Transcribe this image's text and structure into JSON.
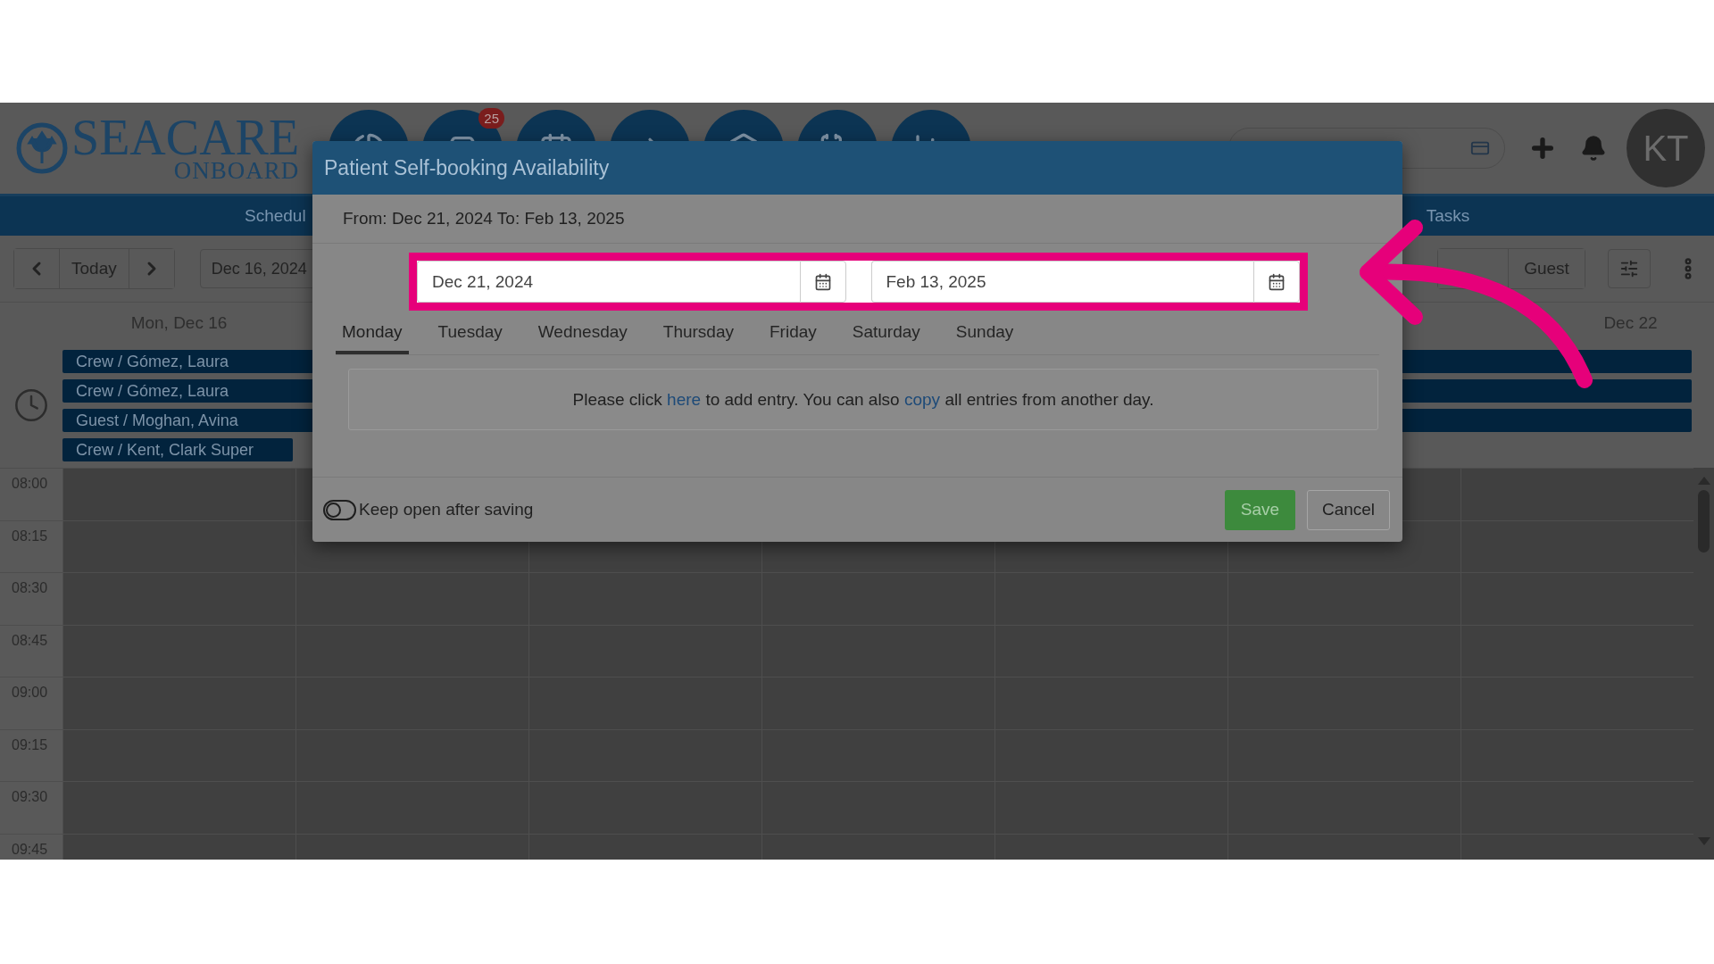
{
  "header": {
    "logo": {
      "name": "SEACARE",
      "sub": "ONBOARD"
    },
    "nav_badge": "25",
    "avatar": "KT"
  },
  "nav_bar": {
    "items": [
      "Schedul",
      "Tasks"
    ]
  },
  "toolbar": {
    "today": "Today",
    "date": "Dec 16, 2024",
    "view": "Guest"
  },
  "calendar": {
    "days": [
      "Mon, Dec 16",
      "Dec 22"
    ],
    "events": [
      {
        "label": "Crew / Gómez, Laura",
        "kind": "week"
      },
      {
        "label": "Crew / Gómez, Laura",
        "kind": "week"
      },
      {
        "label": "Guest / Moghan, Avina",
        "kind": "week"
      },
      {
        "label": "Crew / Kent, Clark Super",
        "kind": "day"
      }
    ],
    "times": [
      "08:00",
      "08:15",
      "08:30",
      "08:45",
      "09:00",
      "09:15",
      "09:30",
      "09:45"
    ]
  },
  "modal": {
    "title": "Patient Self-booking Availability",
    "range": "From: Dec 21, 2024 To: Feb 13, 2025",
    "from_date": "Dec 21, 2024",
    "to_date": "Feb 13, 2025",
    "tabs": [
      {
        "label": "Monday",
        "selected": true
      },
      {
        "label": "Tuesday",
        "selected": false
      },
      {
        "label": "Wednesday",
        "selected": false
      },
      {
        "label": "Thursday",
        "selected": false
      },
      {
        "label": "Friday",
        "selected": false
      },
      {
        "label": "Saturday",
        "selected": false
      },
      {
        "label": "Sunday",
        "selected": false
      }
    ],
    "info": [
      {
        "kind": "text",
        "text": "Please click "
      },
      {
        "kind": "link",
        "text": "here"
      },
      {
        "kind": "text",
        "text": " to add entry. You can also "
      },
      {
        "kind": "link",
        "text": "copy"
      },
      {
        "kind": "text",
        "text": " all entries from another day."
      }
    ],
    "keep_open": {
      "label": "Keep open after saving",
      "on": false
    },
    "save": "Save",
    "cancel": "Cancel"
  }
}
